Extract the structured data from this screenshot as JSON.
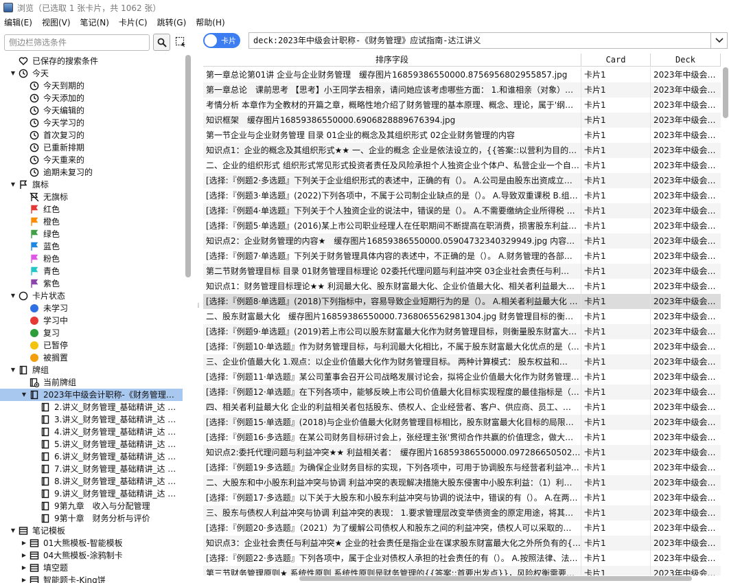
{
  "window": {
    "title": "浏览（已选取 1 张卡片，共 1062 张）"
  },
  "menu": [
    "编辑(E)",
    "视图(V)",
    "笔记(N)",
    "卡片(C)",
    "跳转(G)",
    "帮助(H)"
  ],
  "sidebar": {
    "filter_placeholder": "侧边栏筛选条件",
    "items": [
      {
        "label": "已保存的搜索条件",
        "icon": "heart-icon",
        "level": 0,
        "arrow": ""
      },
      {
        "label": "今天",
        "icon": "clock-icon",
        "level": 0,
        "arrow": "▼"
      },
      {
        "label": "今天到期的",
        "icon": "clock-icon",
        "level": 1,
        "arrow": ""
      },
      {
        "label": "今天添加的",
        "icon": "clock-icon",
        "level": 1,
        "arrow": ""
      },
      {
        "label": "今天编辑的",
        "icon": "clock-icon",
        "level": 1,
        "arrow": ""
      },
      {
        "label": "今天学习的",
        "icon": "clock-icon",
        "level": 1,
        "arrow": ""
      },
      {
        "label": "首次复习的",
        "icon": "clock-icon",
        "level": 1,
        "arrow": ""
      },
      {
        "label": "已重新排期",
        "icon": "clock-icon",
        "level": 1,
        "arrow": ""
      },
      {
        "label": "今天重来的",
        "icon": "clock-icon",
        "level": 1,
        "arrow": ""
      },
      {
        "label": "逾期未复习的",
        "icon": "clock-icon",
        "level": 1,
        "arrow": ""
      },
      {
        "label": "旗标",
        "icon": "flag-outline-icon",
        "level": 0,
        "arrow": "▼"
      },
      {
        "label": "无旗标",
        "icon": "flag-off-icon",
        "level": 1,
        "arrow": ""
      },
      {
        "label": "红色",
        "icon": "flag-icon",
        "color": "#e53935",
        "level": 1,
        "arrow": ""
      },
      {
        "label": "橙色",
        "icon": "flag-icon",
        "color": "#fb8c00",
        "level": 1,
        "arrow": ""
      },
      {
        "label": "绿色",
        "icon": "flag-icon",
        "color": "#43a047",
        "level": 1,
        "arrow": ""
      },
      {
        "label": "蓝色",
        "icon": "flag-icon",
        "color": "#1e88e5",
        "level": 1,
        "arrow": ""
      },
      {
        "label": "粉色",
        "icon": "flag-icon",
        "color": "#e056e6",
        "level": 1,
        "arrow": ""
      },
      {
        "label": "青色",
        "icon": "flag-icon",
        "color": "#26c6c6",
        "level": 1,
        "arrow": ""
      },
      {
        "label": "紫色",
        "icon": "flag-icon",
        "color": "#8e44ad",
        "level": 1,
        "arrow": ""
      },
      {
        "label": "卡片状态",
        "icon": "circle-outline-icon",
        "level": 0,
        "arrow": "▼"
      },
      {
        "label": "未学习",
        "icon": "dot-icon",
        "color": "#2f6fe4",
        "level": 1,
        "arrow": ""
      },
      {
        "label": "学习中",
        "icon": "dot-icon",
        "color": "#e53935",
        "level": 1,
        "arrow": ""
      },
      {
        "label": "复习",
        "icon": "dot-icon",
        "color": "#2e9e3a",
        "level": 1,
        "arrow": ""
      },
      {
        "label": "已暂停",
        "icon": "dot-icon",
        "color": "#f2c40f",
        "level": 1,
        "arrow": ""
      },
      {
        "label": "被搁置",
        "icon": "dot-icon",
        "color": "#f29e0f",
        "level": 1,
        "arrow": ""
      },
      {
        "label": "牌组",
        "icon": "deck-icon",
        "level": 0,
        "arrow": "▼"
      },
      {
        "label": "当前牌组",
        "icon": "current-deck-icon",
        "level": 1,
        "arrow": ""
      },
      {
        "label": "2023年中级会计职称-《财务管理…",
        "icon": "deck-icon",
        "level": 1,
        "arrow": "▼",
        "selected": true
      },
      {
        "label": "2.讲义_财务管理_基础精讲_达 …",
        "icon": "deck-icon",
        "level": 2,
        "arrow": ""
      },
      {
        "label": "3.讲义_财务管理_基础精讲_达 …",
        "icon": "deck-icon",
        "level": 2,
        "arrow": ""
      },
      {
        "label": "4.讲义_财务管理_基础精讲_达 …",
        "icon": "deck-icon",
        "level": 2,
        "arrow": ""
      },
      {
        "label": "5.讲义_财务管理_基础精讲_达 …",
        "icon": "deck-icon",
        "level": 2,
        "arrow": ""
      },
      {
        "label": "6.讲义_财务管理_基础精讲_达 …",
        "icon": "deck-icon",
        "level": 2,
        "arrow": ""
      },
      {
        "label": "7.讲义_财务管理_基础精讲_达 …",
        "icon": "deck-icon",
        "level": 2,
        "arrow": ""
      },
      {
        "label": "8.讲义_财务管理_基础精讲_达 …",
        "icon": "deck-icon",
        "level": 2,
        "arrow": ""
      },
      {
        "label": "9.讲义_财务管理_基础精讲_达 …",
        "icon": "deck-icon",
        "level": 2,
        "arrow": ""
      },
      {
        "label": "9第九章　收入与分配管理",
        "icon": "deck-icon",
        "level": 2,
        "arrow": ""
      },
      {
        "label": "9第十章　财务分析与评价",
        "icon": "deck-icon",
        "level": 2,
        "arrow": ""
      },
      {
        "label": "笔记模板",
        "icon": "note-type-icon",
        "level": 0,
        "arrow": "▼"
      },
      {
        "label": "01大熊模板-智能模板",
        "icon": "note-type-icon",
        "level": 1,
        "arrow": "▶"
      },
      {
        "label": "04大熊模板-涂鸦制卡",
        "icon": "note-type-icon",
        "level": 1,
        "arrow": "▶"
      },
      {
        "label": "填空题",
        "icon": "note-type-icon",
        "level": 1,
        "arrow": "▶"
      },
      {
        "label": "智能题卡-King饼",
        "icon": "note-type-icon",
        "level": 1,
        "arrow": "▶"
      }
    ]
  },
  "toolbar": {
    "toggle_label": "卡片",
    "query": "deck:2023年中级会计职称-《财务管理》应试指南-达江讲义"
  },
  "table": {
    "headers": [
      "排序字段",
      "Card",
      "Deck"
    ],
    "rows": [
      [
        "第一章总论第01讲 企业与企业财务管理　缓存图片16859386550000.8756956802955857.jpg",
        "卡片1",
        "2023年中级会…"
      ],
      [
        "第一章总论　课前思考 【思考】小王同学去相亲，请问她应该考虑哪些方面： 1.和谁相亲（对象）…",
        "卡片1",
        "2023年中级会…"
      ],
      [
        "考情分析 本章作为全教材的开篇之章，概略性地介绍了财务管理的基本原理、概念、理论，属于'纲…",
        "卡片1",
        "2023年中级会…"
      ],
      [
        "知识框架　缓存图片16859386550000.6906828889676394.jpg",
        "卡片1",
        "2023年中级会…"
      ],
      [
        "第一节企业与企业财务管理 目录 01企业的概念及其组织形式 02企业财务管理的内容",
        "卡片1",
        "2023年中级会…"
      ],
      [
        "知识点1：企业的概念及其组织形式★★ 一、企业的概念 企业是依法设立的，{{答案::以营利为目的…",
        "卡片1",
        "2023年中级会…"
      ],
      [
        "二、企业的组织形式 组织形式常见形式投资者责任及风险承担个人独资企业个体户、私营企业一个自…",
        "卡片1",
        "2023年中级会…"
      ],
      [
        "[选择:『例题2·多选题』下列关于企业组织形式的表述中，正确的有（）。 A.公司是由股东出资成立…",
        "卡片1",
        "2023年中级会…"
      ],
      [
        "[选择:『例题3·单选题』(2022)下列各项中，不属于公司制企业缺点的是（）。 A.导致双重课税 B.组…",
        "卡片1",
        "2023年中级会…"
      ],
      [
        "[选择:『例题4·单选题』下列关于个人独资企业的说法中，错误的是（）。 A.不需要缴纳企业所得税 …",
        "卡片1",
        "2023年中级会…"
      ],
      [
        "[选择:『例题5·单选题』(2016)某上市公司职业经理人在任职期间不断提高在职消费，损害股东利益…",
        "卡片1",
        "2023年中级会…"
      ],
      [
        "知识点2：企业财务管理的内容★　缓存图片16859386550000.05904732340329949.jpg 内容说明…",
        "卡片1",
        "2023年中级会…"
      ],
      [
        "[选择:『例题7·单选题』下列关于财务管理具体内容的表述中，不正确的是（）。 A.财务管理的各部…",
        "卡片1",
        "2023年中级会…"
      ],
      [
        "第二节财务管理目标 目录 01财务管理目标理论 02委托代理问题与利益冲突 03企业社会责任与利…",
        "卡片1",
        "2023年中级会…"
      ],
      [
        "知识点1：财务管理目标理论★★ 利润最大化、股东财富最大化、企业价值最大化、相关者利益最大…",
        "卡片1",
        "2023年中级会…"
      ],
      [
        "[选择:『例题8·单选题』(2018)下列指标中，容易导致企业短期行为的是（）。 A.相关者利益最大化 …",
        "卡片1",
        "2023年中级会…"
      ],
      [
        "二、股东财富最大化　缓存图片16859386550000.7368065562981304.jpg 财务管理目标的衡量标…",
        "卡片1",
        "2023年中级会…"
      ],
      [
        "[选择:『例题9·单选题』(2019)若上市公司以股东财富最大化作为财务管理目标，则衡量股东财富大…",
        "卡片1",
        "2023年中级会…"
      ],
      [
        "[选择:『例题10·单选题』作为财务管理目标，与利润最大化相比，不属于股东财富最大化优点的是（…",
        "卡片1",
        "2023年中级会…"
      ],
      [
        "三、企业价值最大化 1.观点：以企业价值最大化作为财务管理目标。 两种计算模式： 股东权益和…",
        "卡片1",
        "2023年中级会…"
      ],
      [
        "[选择:『例题11·单选题』某公司董事会召开公司战略发展讨论会，拟将企业价值最大化作为财务管理…",
        "卡片1",
        "2023年中级会…"
      ],
      [
        "[选择:『例题12·单选题』在下列各项中，能够反映上市公司价值最大化目标实现程度的最佳指标是（…",
        "卡片1",
        "2023年中级会…"
      ],
      [
        "四、相关者利益最大化 企业的利益相关者包括股东、债权人、企业经营者、客户、供应商、员工、…",
        "卡片1",
        "2023年中级会…"
      ],
      [
        "[选择:『例题15·单选题』(2018)与企业价值最大化财务管理目标相比，股东财富最大化目标的局限性…",
        "卡片1",
        "2023年中级会…"
      ],
      [
        "[选择:『例题16·多选题』在某公司财务目标研讨会上，张经理主张'贯彻合作共赢的价值理念，做大…",
        "卡片1",
        "2023年中级会…"
      ],
      [
        "知识点2:委托代理问题与利益冲突★★ 利益相关者：　缓存图片16859386550000.0972866505028…",
        "卡片1",
        "2023年中级会…"
      ],
      [
        "[选择:『例题19·多选题』为确保企业财务目标的实现，下列各项中，可用于协调股东与经营者利益冲…",
        "卡片1",
        "2023年中级会…"
      ],
      [
        "二、大股东和中小股东利益冲突与协调 利益冲突的表现解决措施大股东侵害中小股东利益：（1）利…",
        "卡片1",
        "2023年中级会…"
      ],
      [
        "[选择:『例题17·多选题』以下关于大股东和小股东利益冲突与协调的说法中，错误的有（）。 A.在两…",
        "卡片1",
        "2023年中级会…"
      ],
      [
        "三、股东与债权人利益冲突与协调 利益冲突的表现： 1.要求管理层改变举债资金的原定用途，将其…",
        "卡片1",
        "2023年中级会…"
      ],
      [
        "[选择:『例题20·多选题』（2021）为了缓解公司债权人和股东之间的利益冲突，债权人可以采取的…",
        "卡片1",
        "2023年中级会…"
      ],
      [
        "知识点3：企业社会责任与利益冲突★ 企业的社会责任是指企业在谋求股东财富最大化之外所负有的{{答…",
        "卡片1",
        "2023年中级会…"
      ],
      [
        "[选择:『例题22·多选题』下列各项中，属于企业对债权人承担的社会责任的有（）。 A.按照法律、法…",
        "卡片1",
        "2023年中级会…"
      ],
      [
        "第三节财务管理原则★ 系统性原则 系统性原则是财务管理的{{答案::首要出发点}}，风险权衡需要对{{…",
        "卡片1",
        "2023年中级会…"
      ]
    ],
    "current_row": 15
  },
  "colors": {
    "accent": "#3d7df2",
    "selection": "#a9c8ef"
  }
}
